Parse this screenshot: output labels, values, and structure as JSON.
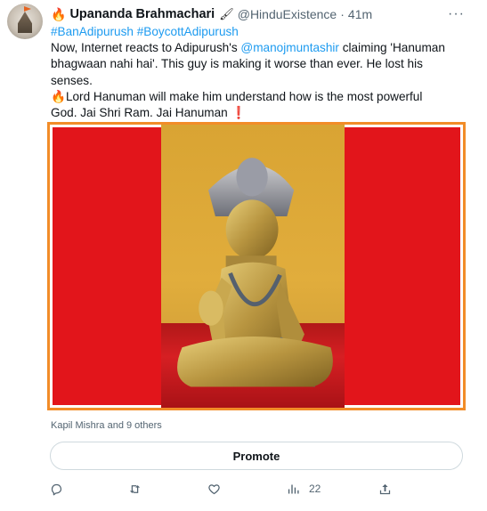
{
  "tweet": {
    "author_name": "Upananda Brahmachari",
    "name_emoji": "🔥",
    "name_brush": "🖌",
    "handle": "@HinduExistence",
    "separator": "·",
    "time": "41m",
    "more_label": "···",
    "hashtags": [
      "#BanAdipurush",
      "#BoycottAdipurush"
    ],
    "text": {
      "l1_a": "Now, Internet reacts to Adipurush's ",
      "l1_mention": "@manojmuntashir",
      "l1_b": "  claiming 'Hanuman",
      "l2": "bhagwaan nahi hai'. This guy is making it worse than ever. He lost his",
      "l3": "senses.",
      "l4_emoji": "🔥",
      "l4": "Lord Hanuman will make him understand how is the most powerful",
      "l5": "God. Jai Shri Ram. Jai Hanuman",
      "l5_emoji": "❗"
    },
    "media": {
      "description": "",
      "border_color": "#f28c28",
      "background_color": "#e2151b"
    },
    "social_context": "Kapil Mishra and 9 others",
    "promote_label": "Promote",
    "actions": {
      "reply": {
        "icon": "reply-icon"
      },
      "retweet": {
        "icon": "retweet-icon"
      },
      "like": {
        "icon": "heart-icon"
      },
      "views": {
        "icon": "views-icon",
        "count": "22"
      },
      "share": {
        "icon": "share-icon"
      }
    }
  },
  "colors": {
    "link": "#1d9bf0",
    "secondary_text": "#536471",
    "primary_text": "#0f1419"
  }
}
